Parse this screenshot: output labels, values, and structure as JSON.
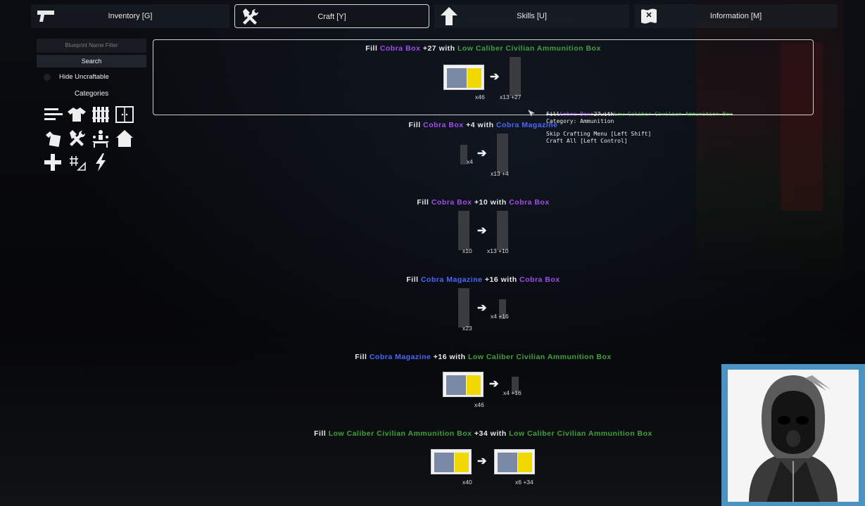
{
  "nav": {
    "tabs": [
      {
        "label": "Inventory [G]",
        "icon": "pistol-icon"
      },
      {
        "label": "Craft [Y]",
        "icon": "hammer-wrench-icon"
      },
      {
        "label": "Skills [U]",
        "icon": "arrow-up-icon"
      },
      {
        "label": "Information [M]",
        "icon": "map-icon"
      }
    ]
  },
  "sidebar": {
    "filter_placeholder": "Blueprint Name Filter",
    "search_label": "Search",
    "hide_uncraftable_label": "Hide Uncraftable",
    "categories_title": "Categories",
    "categories": [
      "list-icon",
      "shirt-icon",
      "fence-icon",
      "door-icon",
      "ammo-icon",
      "tools-icon",
      "workbench-icon",
      "house-icon",
      "medical-plus-icon",
      "sights-icon",
      "lightning-icon"
    ]
  },
  "recipes": [
    {
      "fill": "Fill",
      "item": "Cobra Box",
      "amount": "+27",
      "with": "with",
      "source": "Low Caliber Civilian Ammunition Box",
      "in_qty": "x46",
      "out_qty": "x13 +27"
    },
    {
      "fill": "Fill",
      "item": "Cobra Box",
      "amount": "+4",
      "with": "with",
      "source": "Cobra Magazine",
      "in_qty": "x4",
      "out_qty": "x13 +4"
    },
    {
      "fill": "Fill",
      "item": "Cobra Box",
      "amount": "+10",
      "with": "with",
      "source": "Cobra Box",
      "in_qty": "x10",
      "out_qty": "x13 +10"
    },
    {
      "fill": "Fill",
      "item": "Cobra Magazine",
      "amount": "+16",
      "with": "with",
      "source": "Cobra Box",
      "in_qty": "x23",
      "out_qty": "x4 +16"
    },
    {
      "fill": "Fill",
      "item": "Cobra Magazine",
      "amount": "+16",
      "with": "with",
      "source": "Low Caliber Civilian Ammunition Box",
      "in_qty": "x46",
      "out_qty": "x4 +16"
    },
    {
      "fill": "Fill",
      "item": "Low Caliber Civilian Ammunition Box",
      "amount": "+34",
      "with": "with",
      "source": "Low Caliber Civilian Ammunition Box",
      "in_qty": "x40",
      "out_qty": "x6 +34"
    }
  ],
  "tooltip": {
    "fill": "Fill",
    "item": "Cobra Box",
    "amount": "+27",
    "with": "with",
    "source": "Low Caliber Civilian Ammunition Box",
    "category": "Category: Ammunition",
    "hint1": "Skip Crafting Menu [Left Shift]",
    "hint2": "Craft All [Left Control]"
  },
  "colors": {
    "cobra": "#a44cf0",
    "magazine": "#4a68ff",
    "ammo_box": "#3fa23a",
    "webcam_border": "#4a94c4"
  }
}
